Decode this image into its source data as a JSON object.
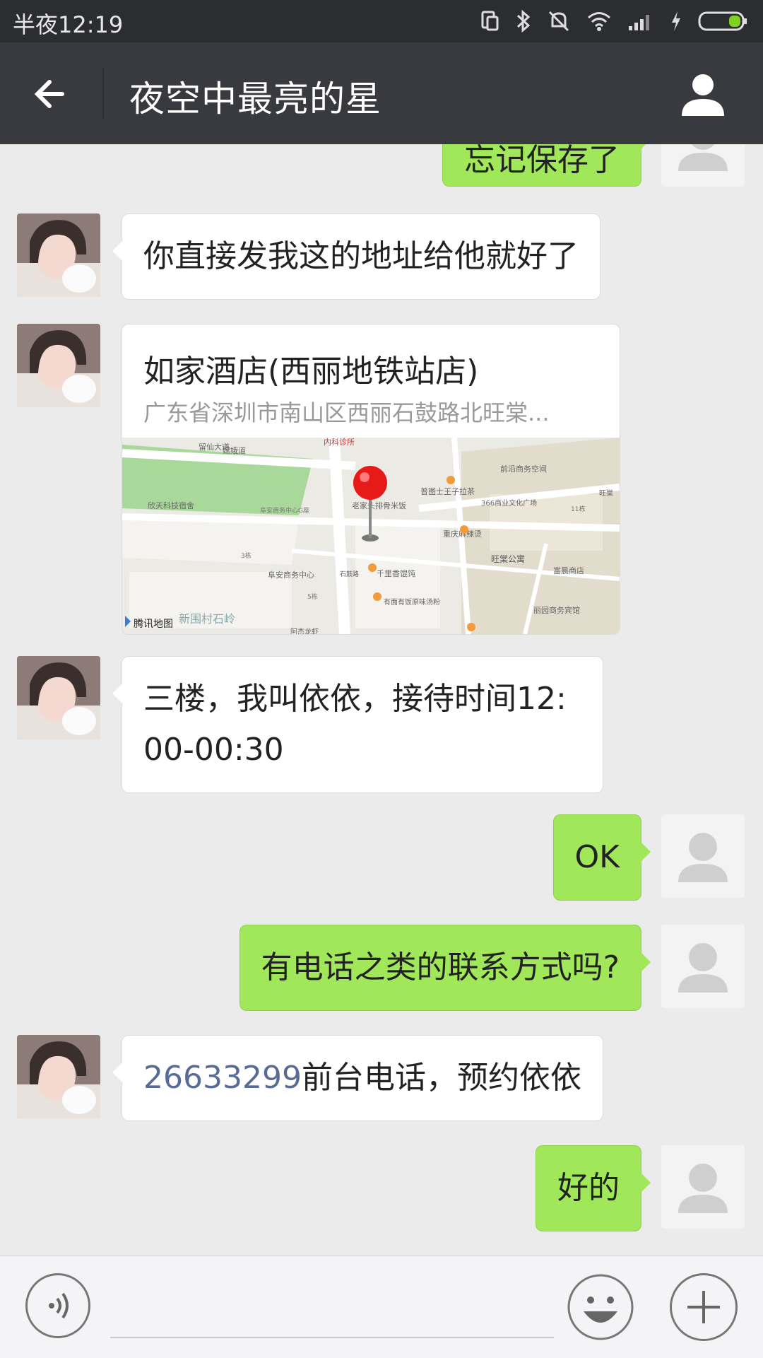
{
  "status_bar": {
    "time": "半夜12:19",
    "icons": [
      "screen-rotate-icon",
      "bluetooth-icon",
      "mute-icon",
      "wifi-icon",
      "signal-icon",
      "charging-icon",
      "battery-icon"
    ]
  },
  "header": {
    "title": "夜空中最亮的星",
    "back_icon": "arrow-left-icon",
    "profile_icon": "person-icon"
  },
  "colors": {
    "header_bg": "#393a3f",
    "status_bg": "#2b2d31",
    "chat_bg": "#ebebeb",
    "outgoing_bubble": "#a0e75a",
    "incoming_bubble": "#ffffff",
    "link": "#576b95"
  },
  "messages": [
    {
      "from": "me",
      "type": "text",
      "text": "忘记保存了"
    },
    {
      "from": "contact",
      "type": "text",
      "text": "你直接发我这的地址给他就好了"
    },
    {
      "from": "contact",
      "type": "location",
      "name": "如家酒店(西丽地铁站店)",
      "address": "广东省深圳市南山区西丽石鼓路北旺棠...",
      "map_provider": "腾讯地图",
      "map_labels": [
        "留仙大道",
        "嫦娥道",
        "内科诊所",
        "前沿商务空间",
        "欣天科技宿舍",
        "阜安商务中心G座",
        "老家头排骨米饭",
        "普图士王子拉茶",
        "366商业文化广场",
        "重庆麻辣烫",
        "旺棠公寓",
        "富晨商店",
        "阜安商务中心",
        "千里香馄饨",
        "有面有饭原味汤粉",
        "丽园商务宾馆",
        "新围村石岭",
        "阿杰龙虾",
        "石鼓路",
        "旺棠",
        "11栋",
        "3栋",
        "5栋"
      ]
    },
    {
      "from": "contact",
      "type": "text",
      "text": "三楼，我叫依依，接待时间12:00-00:30"
    },
    {
      "from": "me",
      "type": "text",
      "text": "OK"
    },
    {
      "from": "me",
      "type": "text",
      "text": "有电话之类的联系方式吗?"
    },
    {
      "from": "contact",
      "type": "text",
      "phone": "26633299",
      "text": "前台电话，预约依依"
    },
    {
      "from": "me",
      "type": "text",
      "text": "好的"
    }
  ],
  "input_bar": {
    "placeholder": "",
    "voice_icon": "voice-icon",
    "emoji_icon": "emoji-icon",
    "more_icon": "plus-icon"
  }
}
